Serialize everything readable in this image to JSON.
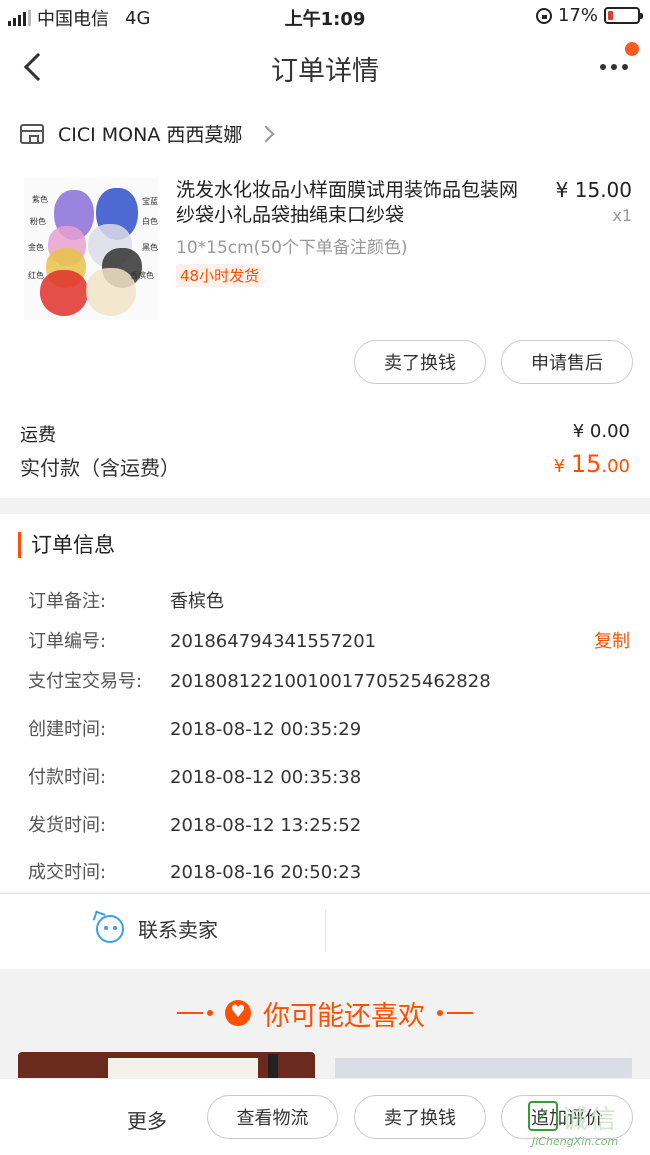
{
  "status_bar": {
    "carrier": "中国电信",
    "network": "4G",
    "time": "上午1:09",
    "battery": "17%",
    "battery_level": 0.17
  },
  "nav": {
    "title": "订单详情"
  },
  "shop": {
    "name": "CICI MONA 西西莫娜"
  },
  "product": {
    "title": "洗发水化妆品小样面膜试用装饰品包装网纱袋小礼品袋抽绳束口纱袋",
    "spec": "10*15cm(50个下单备注颜色)",
    "ship_tag": "48小时发货",
    "price": "¥ 15.00",
    "qty": "x1",
    "image_labels": [
      "紫色",
      "宝蓝",
      "粉色",
      "白色",
      "金色",
      "黑色",
      "红色",
      "香槟色"
    ]
  },
  "actions": {
    "sell_swap": "卖了换钱",
    "after_sale": "申请售后"
  },
  "fee": {
    "label": "运费",
    "value": "¥ 0.00"
  },
  "paid": {
    "label": "实付款（含运费）",
    "currency": "¥ ",
    "integer": "15",
    "decimal": ".00"
  },
  "order_info": {
    "title": "订单信息",
    "rows": [
      {
        "key": "订单备注:",
        "value": "香槟色"
      },
      {
        "key": "订单编号:",
        "value": "201864794341557201"
      },
      {
        "key": "支付宝交易号:",
        "value": "2018081221001001770525462828"
      },
      {
        "key": "创建时间:",
        "value": "2018-08-12 00:35:29"
      },
      {
        "key": "付款时间:",
        "value": "2018-08-12 00:35:38"
      },
      {
        "key": "发货时间:",
        "value": "2018-08-12 13:25:52"
      },
      {
        "key": "成交时间:",
        "value": "2018-08-16 20:50:23"
      }
    ],
    "copy_label": "复制"
  },
  "contact": {
    "label": "联系卖家"
  },
  "recommend": {
    "title": "你可能还喜欢"
  },
  "bottom_bar": {
    "more": "更多",
    "logistics": "查看物流",
    "sell_swap": "卖了换钱",
    "review": "追加评价"
  },
  "watermark": {
    "text": "诚信",
    "url": "JiChengXin.com"
  },
  "colors": {
    "accent": "#ff5000",
    "contact": "#3aa0e8"
  }
}
